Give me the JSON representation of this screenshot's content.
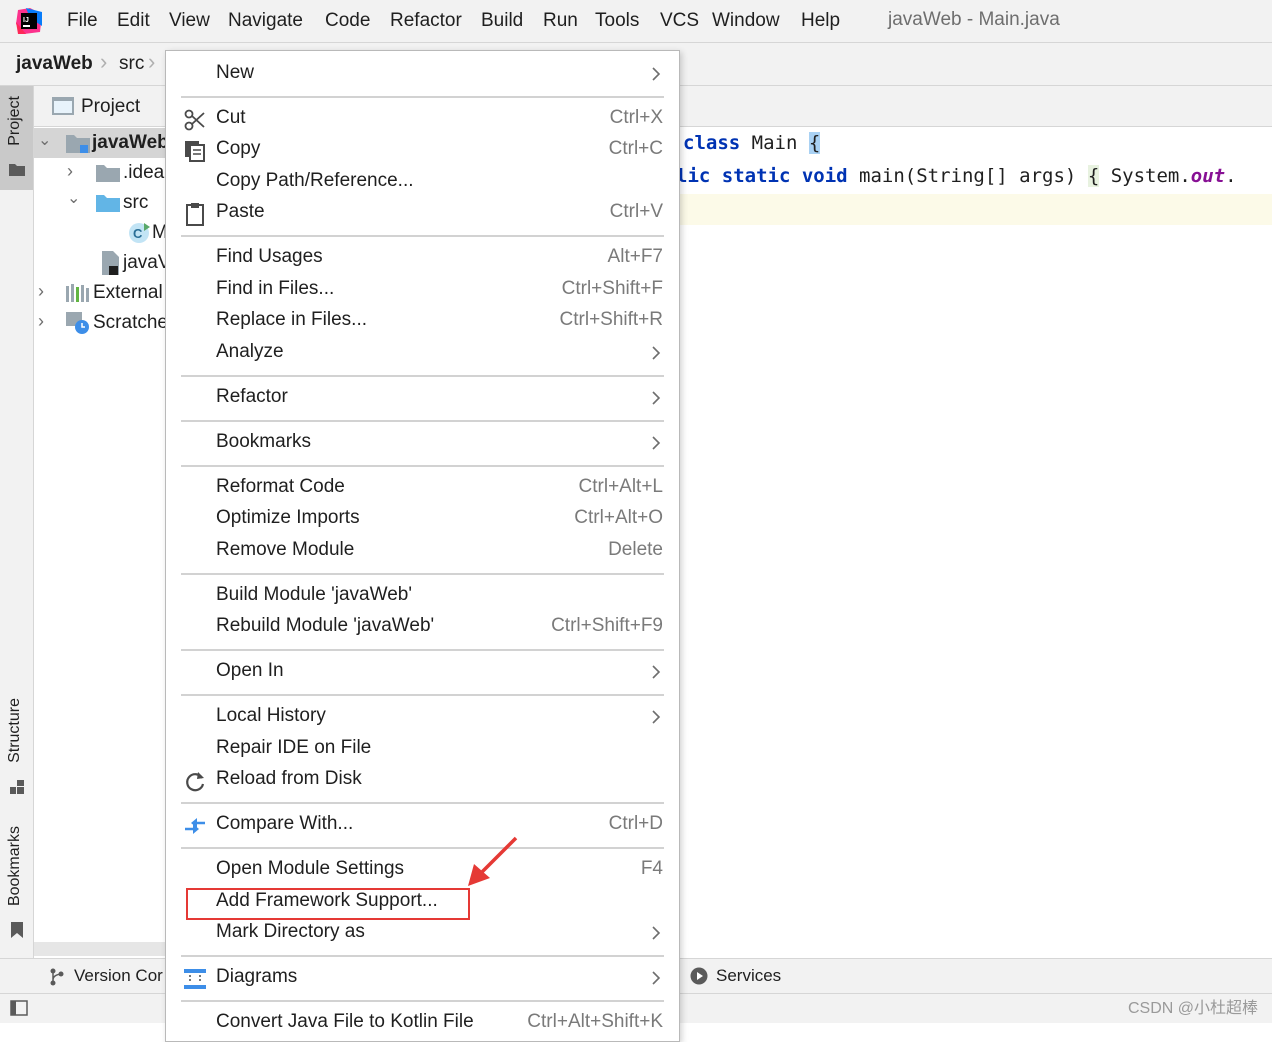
{
  "menubar": {
    "items": [
      {
        "label": "File"
      },
      {
        "label": "Edit"
      },
      {
        "label": "View"
      },
      {
        "label": "Navigate"
      },
      {
        "label": "Code"
      },
      {
        "label": "Refactor"
      },
      {
        "label": "Build"
      },
      {
        "label": "Run"
      },
      {
        "label": "Tools"
      },
      {
        "label": "VCS"
      },
      {
        "label": "Window"
      },
      {
        "label": "Help"
      }
    ],
    "title": "javaWeb - Main.java"
  },
  "breadcrumb": {
    "project": "javaWeb",
    "folder": "src"
  },
  "toolwindows": {
    "project": "Project",
    "structure": "Structure",
    "bookmarks": "Bookmarks"
  },
  "project_panel": {
    "header": "Project",
    "tree": [
      {
        "label": "javaWeb"
      },
      {
        "label": ".idea"
      },
      {
        "label": "src"
      },
      {
        "label": "M"
      },
      {
        "label": "javaV"
      },
      {
        "label": "External"
      },
      {
        "label": "Scratche"
      }
    ]
  },
  "editor": {
    "line1": {
      "kw": "class",
      "name": " Main ",
      "brace": "{"
    },
    "line2": {
      "kw": "lic static void",
      "plain": " main(String[] args) ",
      "brace": "{",
      "rest": " System.",
      "field": "out",
      "dot": "."
    }
  },
  "context_menu": {
    "items": [
      {
        "label": "New",
        "shortcut": "",
        "submenu": true
      },
      {
        "label": "Cut",
        "shortcut": "Ctrl+X"
      },
      {
        "label": "Copy",
        "shortcut": "Ctrl+C"
      },
      {
        "label": "Copy Path/Reference...",
        "shortcut": ""
      },
      {
        "label": "Paste",
        "shortcut": "Ctrl+V"
      },
      {
        "label": "Find Usages",
        "shortcut": "Alt+F7"
      },
      {
        "label": "Find in Files...",
        "shortcut": "Ctrl+Shift+F"
      },
      {
        "label": "Replace in Files...",
        "shortcut": "Ctrl+Shift+R"
      },
      {
        "label": "Analyze",
        "shortcut": "",
        "submenu": true
      },
      {
        "label": "Refactor",
        "shortcut": "",
        "submenu": true
      },
      {
        "label": "Bookmarks",
        "shortcut": "",
        "submenu": true
      },
      {
        "label": "Reformat Code",
        "shortcut": "Ctrl+Alt+L"
      },
      {
        "label": "Optimize Imports",
        "shortcut": "Ctrl+Alt+O"
      },
      {
        "label": "Remove Module",
        "shortcut": "Delete"
      },
      {
        "label": "Build Module 'javaWeb'",
        "shortcut": ""
      },
      {
        "label": "Rebuild Module 'javaWeb'",
        "shortcut": "Ctrl+Shift+F9"
      },
      {
        "label": "Open In",
        "shortcut": "",
        "submenu": true
      },
      {
        "label": "Local History",
        "shortcut": "",
        "submenu": true
      },
      {
        "label": "Repair IDE on File",
        "shortcut": ""
      },
      {
        "label": "Reload from Disk",
        "shortcut": ""
      },
      {
        "label": "Compare With...",
        "shortcut": "Ctrl+D"
      },
      {
        "label": "Open Module Settings",
        "shortcut": "F4"
      },
      {
        "label": "Add Framework Support...",
        "shortcut": ""
      },
      {
        "label": "Mark Directory as",
        "shortcut": "",
        "submenu": true
      },
      {
        "label": "Diagrams",
        "shortcut": "",
        "submenu": true
      },
      {
        "label": "Convert Java File to Kotlin File",
        "shortcut": "Ctrl+Alt+Shift+K"
      }
    ]
  },
  "bottom": {
    "version_control": "Version Cor",
    "services": "Services"
  },
  "watermark": "CSDN @小杜超棒",
  "colors": {
    "highlight_box": "#e53935",
    "keyword": "#0033b3",
    "field": "#871094"
  }
}
